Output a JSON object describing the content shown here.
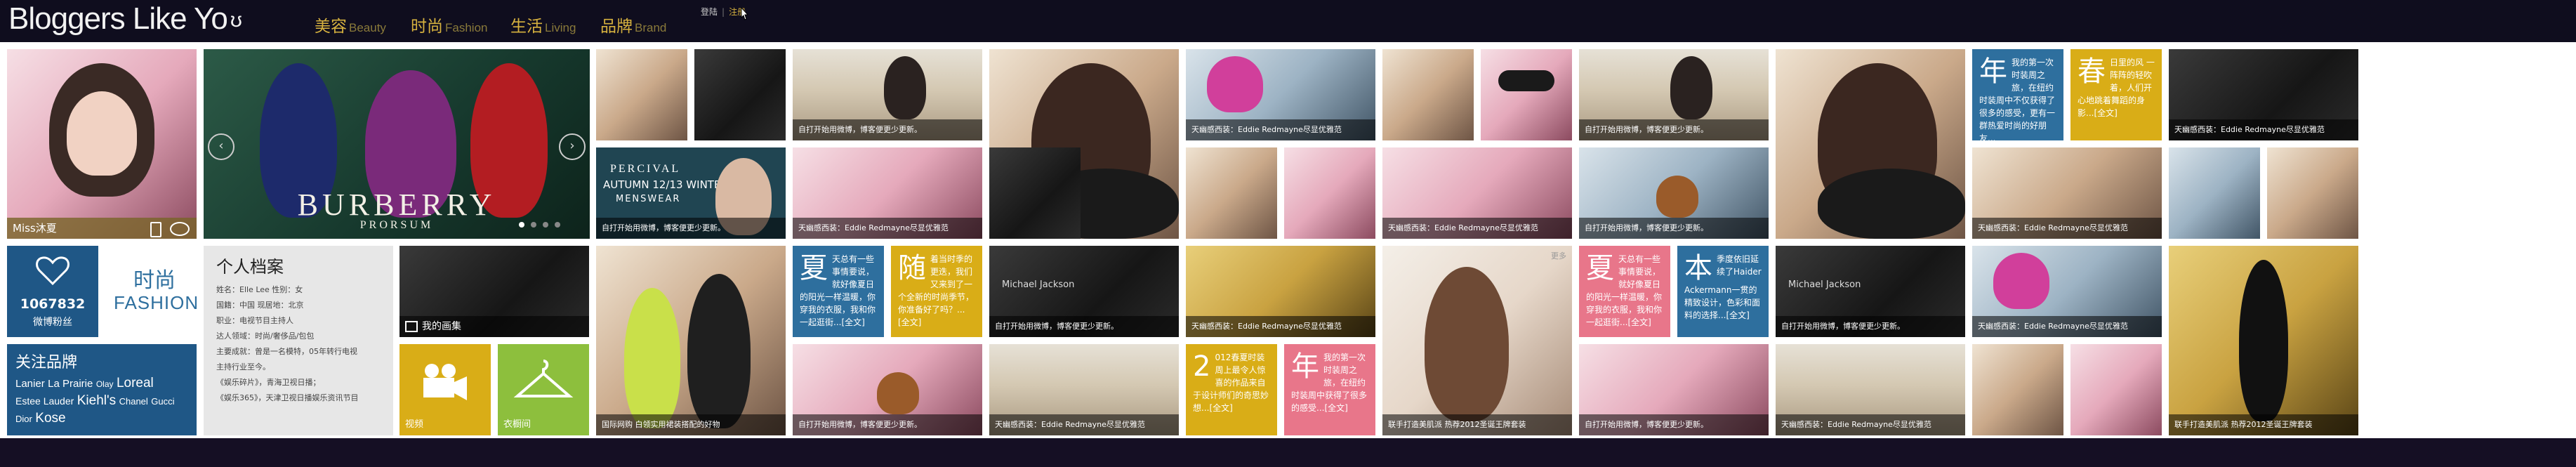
{
  "header": {
    "logo_text": "Bloggers Like Yo",
    "logo_mark": "ʊ",
    "nav": [
      {
        "cn": "美容",
        "en": "Beauty"
      },
      {
        "cn": "时尚",
        "en": "Fashion"
      },
      {
        "cn": "生活",
        "en": "Living"
      },
      {
        "cn": "品牌",
        "en": "Brand"
      }
    ],
    "login": "登陆",
    "register": "注册",
    "separator": "|"
  },
  "profile": {
    "name": "Miss沐夏"
  },
  "banner": {
    "brand": "BURBERRY",
    "sub": "PRORSUM"
  },
  "fans": {
    "count": "1067832",
    "label": "微博粉丝"
  },
  "fashion_logo": {
    "cn": "时尚",
    "en": "FASHION"
  },
  "brands": {
    "title": "关注品牌",
    "items": [
      "Lanier",
      "La Prairie",
      "Olay",
      "Loreal",
      "Estee Lauder",
      "Kiehl's",
      "Chanel",
      "Gucci",
      "Dior",
      "Kose"
    ]
  },
  "dossier": {
    "title": "个人档案",
    "lines": [
      "姓名：Elle Lee        性别：女",
      "国籍：中国            现居地：北京",
      "职业：电视节目主持人",
      "达人领域：时尚/奢侈品/包包",
      "主要成就：曾是一名模特，05年转行电视",
      "主持行业至今。",
      "《娱乐碎片》，青海卫视日播；",
      "《娱乐365》，天津卫视日播娱乐资讯节目"
    ]
  },
  "tiles": {
    "album": "我的画集",
    "video": "视频",
    "wardrobe": "衣橱间",
    "percival": [
      "PERCIVAL",
      "AUTUMN 12/13 WINTER",
      "MENSWEAR"
    ],
    "mj": "Michael Jackson",
    "caption_open": "自打开始用微博，博客便更少更新。",
    "caption_eddie": "天幽感西装：Eddie Redmayne尽显优雅范",
    "caption_damian": "国际网购 白领实用裙装搭配的好物",
    "caption_seoul": "联手打造美肌派 热荐2012圣诞王牌套装",
    "tag_more": "更多",
    "text1": "年",
    "text1_body": "我的第一次时装周之旅，在纽约时装周中不仅获得了很多的感受，更有一群热爱时尚的好朋友...",
    "text2": "春",
    "text2_body": "日里的风 一阵阵的轻吹着，人们开心地跳着舞蹈的身影...[全文]",
    "text3": "夏",
    "text3_body": "天总有一些事情要说，就好像夏日的阳光一样温暖，你穿我的衣服，我和你一起逛街...[全文]",
    "text4": "随",
    "text4_body": "着当时季的更迭，我们又来到了一个全新的时尚季节，你准备好了吗？...[全文]",
    "text5": "本",
    "text5_body": "季度依旧延续了Haider Ackermann一贯的精致设计，色彩和面料的选择...[全文]",
    "text6": "2",
    "text6_body": "012春夏时装周上最令人惊喜的作品来自于设计师们的奇思妙想...[全文]",
    "text7": "年",
    "text7_body": "我的第一次时装周之旅，在纽约时装周中获得了很多的感受...[全文]"
  }
}
